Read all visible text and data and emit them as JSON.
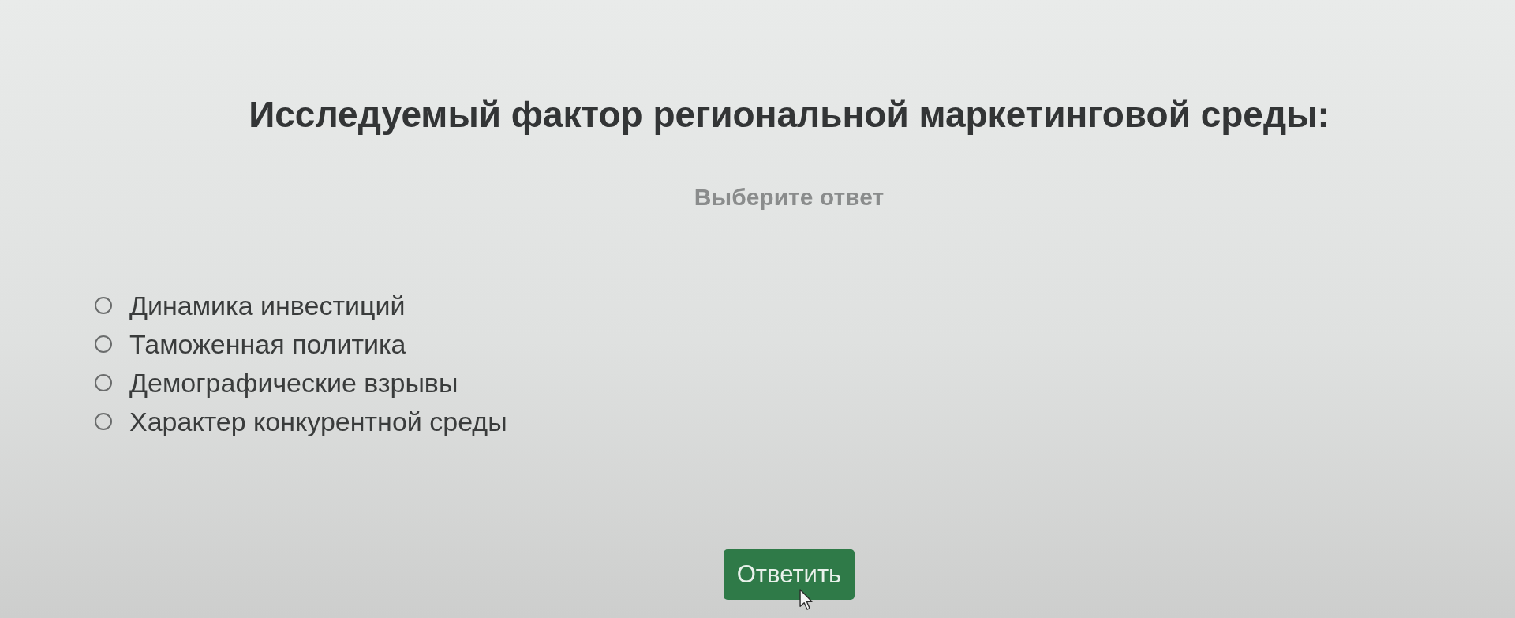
{
  "question": {
    "title": "Исследуемый фактор региональной маркетинговой среды:",
    "hint": "Выберите ответ"
  },
  "options": [
    {
      "label": "Динамика инвестиций",
      "selected": false
    },
    {
      "label": "Таможенная политика",
      "selected": false
    },
    {
      "label": "Демографические взрывы",
      "selected": false
    },
    {
      "label": "Характер конкурентной среды",
      "selected": false
    }
  ],
  "submit_button": {
    "label": "Ответить"
  }
}
